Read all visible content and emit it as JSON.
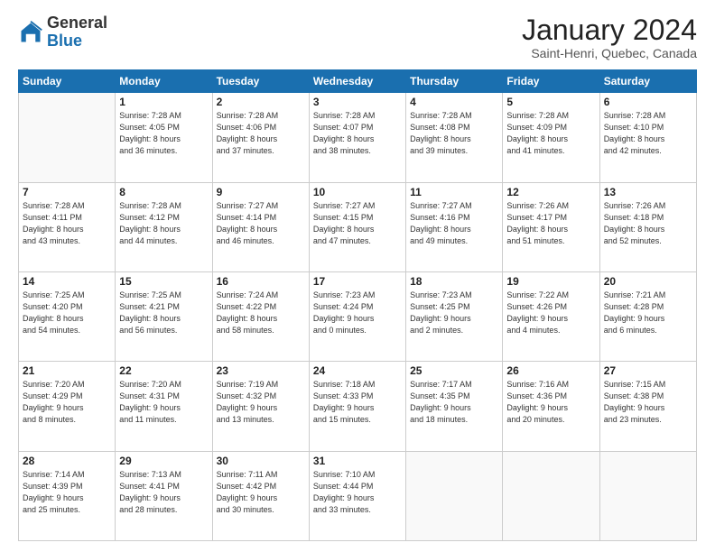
{
  "logo": {
    "general": "General",
    "blue": "Blue"
  },
  "header": {
    "month": "January 2024",
    "location": "Saint-Henri, Quebec, Canada"
  },
  "weekdays": [
    "Sunday",
    "Monday",
    "Tuesday",
    "Wednesday",
    "Thursday",
    "Friday",
    "Saturday"
  ],
  "weeks": [
    [
      {
        "day": "",
        "info": ""
      },
      {
        "day": "1",
        "info": "Sunrise: 7:28 AM\nSunset: 4:05 PM\nDaylight: 8 hours\nand 36 minutes."
      },
      {
        "day": "2",
        "info": "Sunrise: 7:28 AM\nSunset: 4:06 PM\nDaylight: 8 hours\nand 37 minutes."
      },
      {
        "day": "3",
        "info": "Sunrise: 7:28 AM\nSunset: 4:07 PM\nDaylight: 8 hours\nand 38 minutes."
      },
      {
        "day": "4",
        "info": "Sunrise: 7:28 AM\nSunset: 4:08 PM\nDaylight: 8 hours\nand 39 minutes."
      },
      {
        "day": "5",
        "info": "Sunrise: 7:28 AM\nSunset: 4:09 PM\nDaylight: 8 hours\nand 41 minutes."
      },
      {
        "day": "6",
        "info": "Sunrise: 7:28 AM\nSunset: 4:10 PM\nDaylight: 8 hours\nand 42 minutes."
      }
    ],
    [
      {
        "day": "7",
        "info": "Sunrise: 7:28 AM\nSunset: 4:11 PM\nDaylight: 8 hours\nand 43 minutes."
      },
      {
        "day": "8",
        "info": "Sunrise: 7:28 AM\nSunset: 4:12 PM\nDaylight: 8 hours\nand 44 minutes."
      },
      {
        "day": "9",
        "info": "Sunrise: 7:27 AM\nSunset: 4:14 PM\nDaylight: 8 hours\nand 46 minutes."
      },
      {
        "day": "10",
        "info": "Sunrise: 7:27 AM\nSunset: 4:15 PM\nDaylight: 8 hours\nand 47 minutes."
      },
      {
        "day": "11",
        "info": "Sunrise: 7:27 AM\nSunset: 4:16 PM\nDaylight: 8 hours\nand 49 minutes."
      },
      {
        "day": "12",
        "info": "Sunrise: 7:26 AM\nSunset: 4:17 PM\nDaylight: 8 hours\nand 51 minutes."
      },
      {
        "day": "13",
        "info": "Sunrise: 7:26 AM\nSunset: 4:18 PM\nDaylight: 8 hours\nand 52 minutes."
      }
    ],
    [
      {
        "day": "14",
        "info": "Sunrise: 7:25 AM\nSunset: 4:20 PM\nDaylight: 8 hours\nand 54 minutes."
      },
      {
        "day": "15",
        "info": "Sunrise: 7:25 AM\nSunset: 4:21 PM\nDaylight: 8 hours\nand 56 minutes."
      },
      {
        "day": "16",
        "info": "Sunrise: 7:24 AM\nSunset: 4:22 PM\nDaylight: 8 hours\nand 58 minutes."
      },
      {
        "day": "17",
        "info": "Sunrise: 7:23 AM\nSunset: 4:24 PM\nDaylight: 9 hours\nand 0 minutes."
      },
      {
        "day": "18",
        "info": "Sunrise: 7:23 AM\nSunset: 4:25 PM\nDaylight: 9 hours\nand 2 minutes."
      },
      {
        "day": "19",
        "info": "Sunrise: 7:22 AM\nSunset: 4:26 PM\nDaylight: 9 hours\nand 4 minutes."
      },
      {
        "day": "20",
        "info": "Sunrise: 7:21 AM\nSunset: 4:28 PM\nDaylight: 9 hours\nand 6 minutes."
      }
    ],
    [
      {
        "day": "21",
        "info": "Sunrise: 7:20 AM\nSunset: 4:29 PM\nDaylight: 9 hours\nand 8 minutes."
      },
      {
        "day": "22",
        "info": "Sunrise: 7:20 AM\nSunset: 4:31 PM\nDaylight: 9 hours\nand 11 minutes."
      },
      {
        "day": "23",
        "info": "Sunrise: 7:19 AM\nSunset: 4:32 PM\nDaylight: 9 hours\nand 13 minutes."
      },
      {
        "day": "24",
        "info": "Sunrise: 7:18 AM\nSunset: 4:33 PM\nDaylight: 9 hours\nand 15 minutes."
      },
      {
        "day": "25",
        "info": "Sunrise: 7:17 AM\nSunset: 4:35 PM\nDaylight: 9 hours\nand 18 minutes."
      },
      {
        "day": "26",
        "info": "Sunrise: 7:16 AM\nSunset: 4:36 PM\nDaylight: 9 hours\nand 20 minutes."
      },
      {
        "day": "27",
        "info": "Sunrise: 7:15 AM\nSunset: 4:38 PM\nDaylight: 9 hours\nand 23 minutes."
      }
    ],
    [
      {
        "day": "28",
        "info": "Sunrise: 7:14 AM\nSunset: 4:39 PM\nDaylight: 9 hours\nand 25 minutes."
      },
      {
        "day": "29",
        "info": "Sunrise: 7:13 AM\nSunset: 4:41 PM\nDaylight: 9 hours\nand 28 minutes."
      },
      {
        "day": "30",
        "info": "Sunrise: 7:11 AM\nSunset: 4:42 PM\nDaylight: 9 hours\nand 30 minutes."
      },
      {
        "day": "31",
        "info": "Sunrise: 7:10 AM\nSunset: 4:44 PM\nDaylight: 9 hours\nand 33 minutes."
      },
      {
        "day": "",
        "info": ""
      },
      {
        "day": "",
        "info": ""
      },
      {
        "day": "",
        "info": ""
      }
    ]
  ]
}
